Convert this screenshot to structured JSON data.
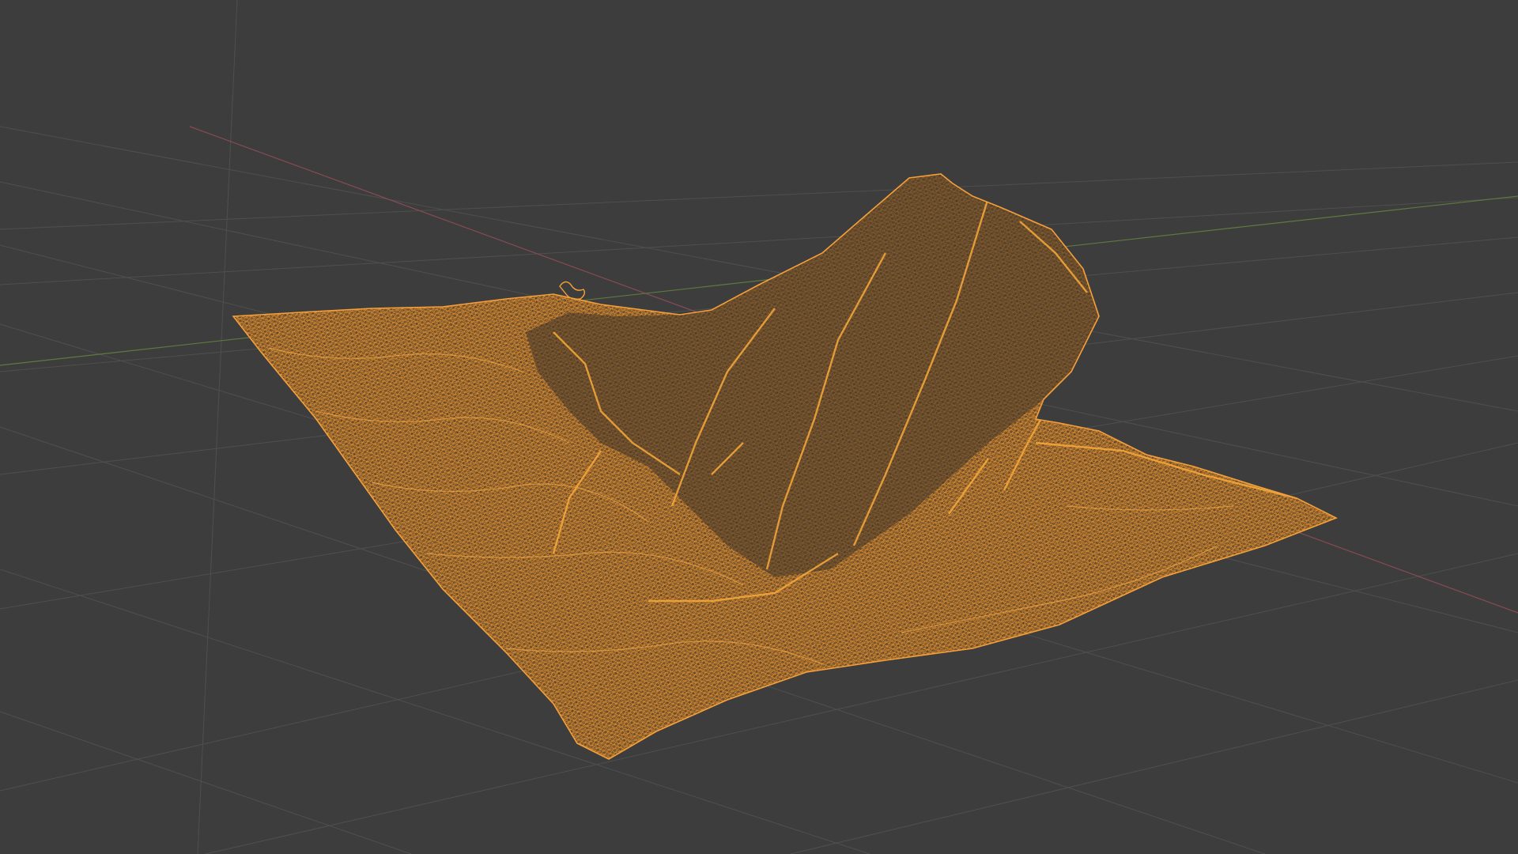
{
  "viewport": {
    "view_mode": "wireframe",
    "object_selected": true,
    "overlays": {
      "grid_floor": true,
      "axis_x": true,
      "axis_y": true
    }
  },
  "colors": {
    "background": "#3d3d3d",
    "grid_line": "#505050",
    "axis_x": "#8a4a55",
    "axis_y": "#5e7a3e",
    "selected_wire": "#f29a2b",
    "mesh_fill": "#5a4330"
  },
  "objects": [
    {
      "name_visible": false,
      "type": "mesh",
      "selected": true
    }
  ]
}
